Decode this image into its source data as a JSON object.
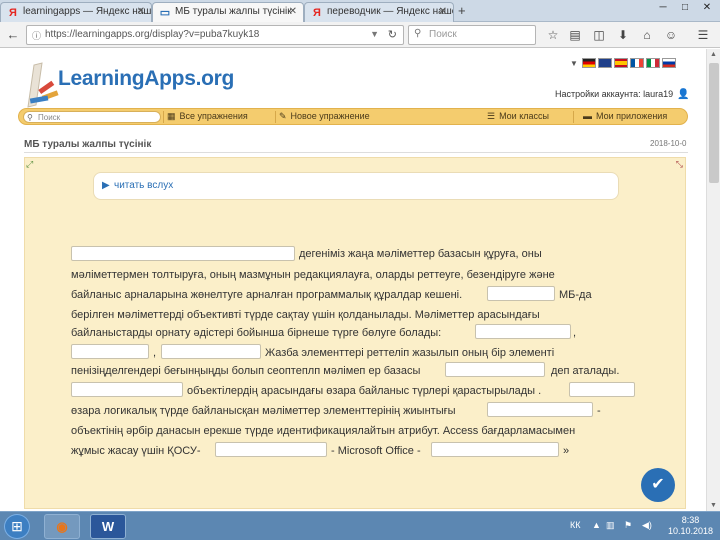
{
  "browser": {
    "tabs": [
      {
        "title": "learningapps — Яндекс нашёл",
        "icon": "Я"
      },
      {
        "title": "МБ туралы жалпы түсінік",
        "icon": "▭",
        "active": true
      },
      {
        "title": "переводчик — Яндекс нашёл",
        "icon": "Я"
      }
    ],
    "url": "https://learningapps.org/display?v=puba7kuyk18",
    "search_placeholder": "Поиск"
  },
  "site": {
    "logo": "LearningApps.org",
    "account": "Настройки аккаунта: laura19",
    "menu": {
      "search_placeholder": "Поиск",
      "all_exercises": "Все упражнения",
      "new_exercise": "Новое упражнение",
      "my_classes": "Мои классы",
      "my_apps": "Мои приложения"
    },
    "page_title": "МБ туралы жалпы түсінік",
    "page_date": "2018-10-0"
  },
  "exercise": {
    "read_label": "читать вслух",
    "l1": "деп аталады.",
    "l2_a": "деп аталады.",
    "t1_after": "дегеніміз жаңа мәліметтер базасын құруға, оны",
    "t2": "мәліметтермен толтыруға, оның мазмұнын редакциялауға, оларды реттеуге, безендіруге және",
    "t3_a": "байланыс арналарына жөнелтуге арналған программалық құралдар кешені.",
    "t3_b": "МБ-да",
    "t4": "берілген мәліметтерді объективті түрде сақтау үшін қолданылады. Мәліметтер арасындағы",
    "t5": "байланыстарды орнату әдістері бойынша бірнеше түрге бөлуге болады:",
    "t5_comma": ",",
    "t6_comma": ",",
    "t6": "Жазба элементтері реттеліп жазылып оның бір элементі",
    "t7_a": "пенізіңделгендері беғынңыңды болып сеоптеплп мәлімеп ер базасы",
    "t7_b": "деп аталады.",
    "t8": "объектілердің арасындағы өзара байланыс түрлері қарастырылады .",
    "t9_a": "өзара логикалық түрде байланысқан мәліметтер элементтерінің жиынтығы",
    "t9_b": "-",
    "t10": "объектінің әрбір данасын ерекше түрде идентификациялайтын атрибут. Access бағдарламасымен",
    "t11_a": "жұмыс жасау үшін ҚОСУ-",
    "t11_b": "- Microsoft Office -",
    "t11_c": "»"
  },
  "taskbar": {
    "lang": "КК",
    "time": "8:38",
    "date": "10.10.2018"
  },
  "colors": {
    "accent": "#2a6fb5",
    "menu": "#f4cc6e",
    "content_bg": "#fbefc9"
  }
}
